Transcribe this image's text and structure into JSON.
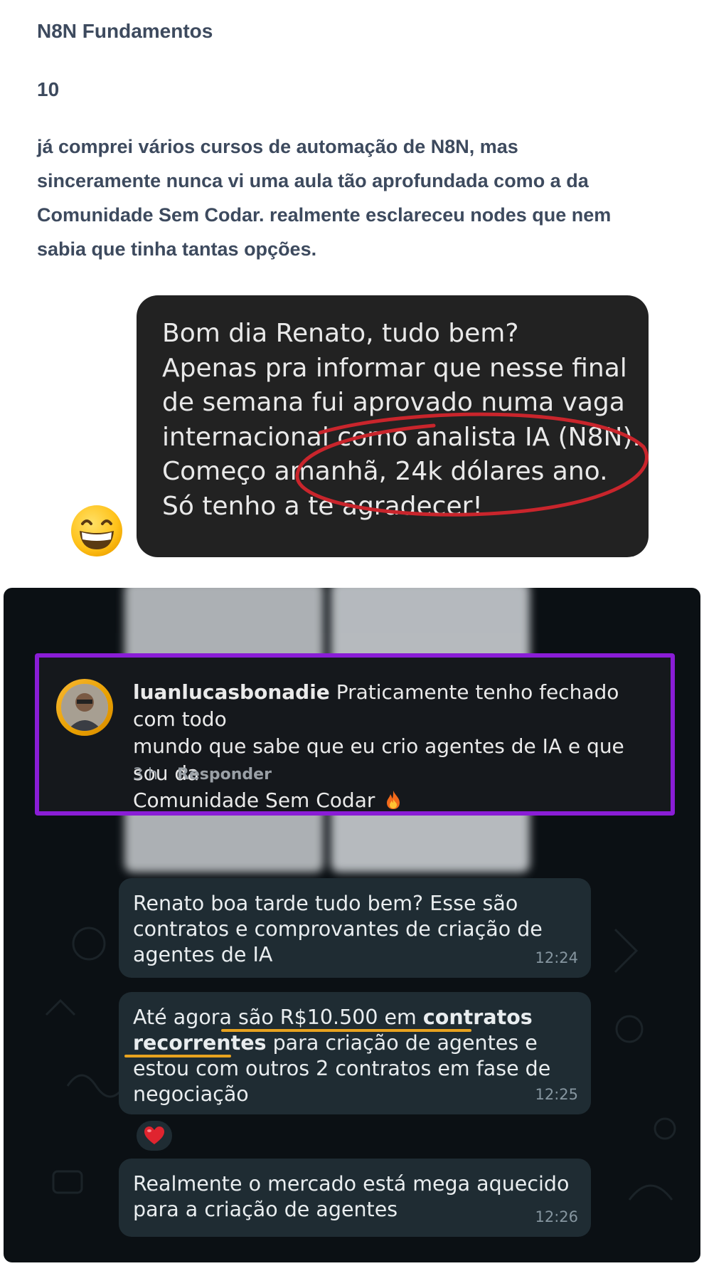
{
  "review": {
    "title": "N8N Fundamentos",
    "rating": "10",
    "lines": [
      "já comprei vários cursos de automação de N8N, mas",
      "sinceramente nunca vi uma aula tão aprofundada como a da",
      "Comunidade Sem Codar. realmente esclareceu nodes que nem",
      "sabia que tinha tantas opções."
    ]
  },
  "message": {
    "lines": [
      "Bom dia Renato, tudo bem?",
      "Apenas pra informar que nesse final",
      "de semana fui aprovado numa vaga",
      "internacional como analista IA (N8N).",
      "Começo amanhã, 24k dólares ano.",
      "Só tenho a te agradecer!"
    ],
    "emoji": "grinning-face-emoji",
    "highlight_color": "#c9252c"
  },
  "comment": {
    "username": "luanlucasbonadie",
    "text_line1": " Praticamente tenho fechado com todo",
    "text_line2": "mundo que sabe que eu crio agentes de IA e que sou da",
    "text_line3": "Comunidade Sem Codar",
    "emoji": "fire-icon",
    "time": "3 h",
    "reply_label": "Responder",
    "border_color": "#8a1dd6"
  },
  "chat": {
    "bubbles": [
      {
        "lines": [
          "Renato boa tarde tudo bem? Esse são",
          "contratos e comprovantes de criação de",
          "agentes de IA"
        ],
        "time": "12:24"
      },
      {
        "line1_a": "Até agora ",
        "line1_b": "são R$10.500 em ",
        "line1_c": "contratos",
        "line2_a": "recorrentes",
        "line2_b": " para criação de agentes e",
        "line3": "estou com outros 2 contratos em fase de",
        "line4": "negociação",
        "time": "12:25",
        "reaction": "heart-icon"
      },
      {
        "lines": [
          "Realmente o mercado está mega aquecido",
          "para a criação de agentes"
        ],
        "time": "12:26"
      }
    ],
    "underline_color": "#e8a31f"
  }
}
